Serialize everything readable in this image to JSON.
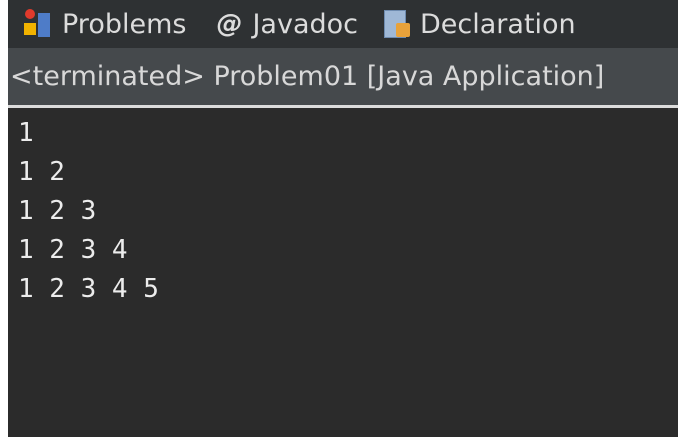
{
  "tabs": [
    {
      "label": "Problems",
      "icon": "problems-icon"
    },
    {
      "label": "Javadoc",
      "icon": "at-sign-icon"
    },
    {
      "label": "Declaration",
      "icon": "declaration-icon"
    }
  ],
  "status": {
    "text": "<terminated> Problem01 [Java Application]"
  },
  "console": {
    "lines": [
      "1",
      "1 2",
      "1 2 3",
      "1 2 3 4",
      "1 2 3 4 5"
    ]
  },
  "colors": {
    "tabbar_bg": "#2e3133",
    "status_bg": "#45494c",
    "console_bg": "#2b2b2b",
    "console_text": "#ececec"
  }
}
